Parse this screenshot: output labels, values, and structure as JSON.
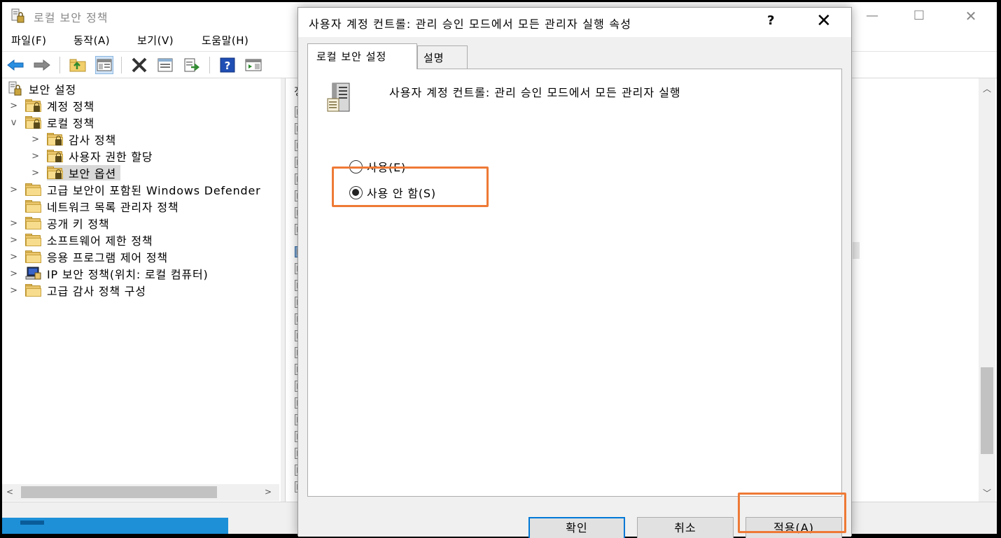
{
  "main_window": {
    "title": "로컬 보안 정책",
    "controls": {
      "minimize": "—",
      "maximize": "☐",
      "close": "✕"
    }
  },
  "menu": [
    {
      "label": "파일(F)"
    },
    {
      "label": "동작(A)"
    },
    {
      "label": "보기(V)"
    },
    {
      "label": "도움말(H)"
    }
  ],
  "toolbar": {
    "icons": [
      "back-arrow-icon",
      "forward-arrow-icon",
      "up-folder-icon",
      "show-hide-tree-icon",
      "delete-icon",
      "properties-icon",
      "export-list-icon",
      "help-icon",
      "show-hide-action-pane-icon"
    ]
  },
  "tree": {
    "items": [
      {
        "label": "보안 설정"
      },
      {
        "label": "계정 정책"
      },
      {
        "label": "로컬 정책"
      },
      {
        "label": "감사 정책"
      },
      {
        "label": "사용자 권한 할당"
      },
      {
        "label": "보안 옵션"
      },
      {
        "label": "고급 보안이 포함된 Windows Defender"
      },
      {
        "label": "네트워크 목록 관리자 정책"
      },
      {
        "label": "공개 키 정책"
      },
      {
        "label": "소프트웨어 제한 정책"
      },
      {
        "label": "응용 프로그램 제어 정책"
      },
      {
        "label": "IP 보안 정책(위치: 로컬 컴퓨터)"
      },
      {
        "label": "고급 감사 정책 구성"
      }
    ],
    "chevron_collapsed": ">",
    "chevron_expanded": "v"
  },
  "list_pane": {
    "header_fragment": "정"
  },
  "dialog": {
    "title": "사용자 계정 컨트롤: 관리 승인 모드에서 모든 관리자 실행 속성",
    "help": "?",
    "close": "✕",
    "tabs": [
      {
        "label": "로컬 보안 설정",
        "active": true
      },
      {
        "label": "설명",
        "active": false
      }
    ],
    "policy_name": "사용자 계정 컨트롤: 관리 승인 모드에서 모든 관리자 실행",
    "options": [
      {
        "label": "사용(E)",
        "checked": false
      },
      {
        "label": "사용 안 함(S)",
        "checked": true
      }
    ],
    "buttons": {
      "ok": "확인",
      "cancel": "취소",
      "apply": "적용(A)"
    }
  },
  "colors": {
    "highlight": "#ee7a36",
    "focus_border": "#0078d7",
    "taskbar": "#1e90d8"
  }
}
